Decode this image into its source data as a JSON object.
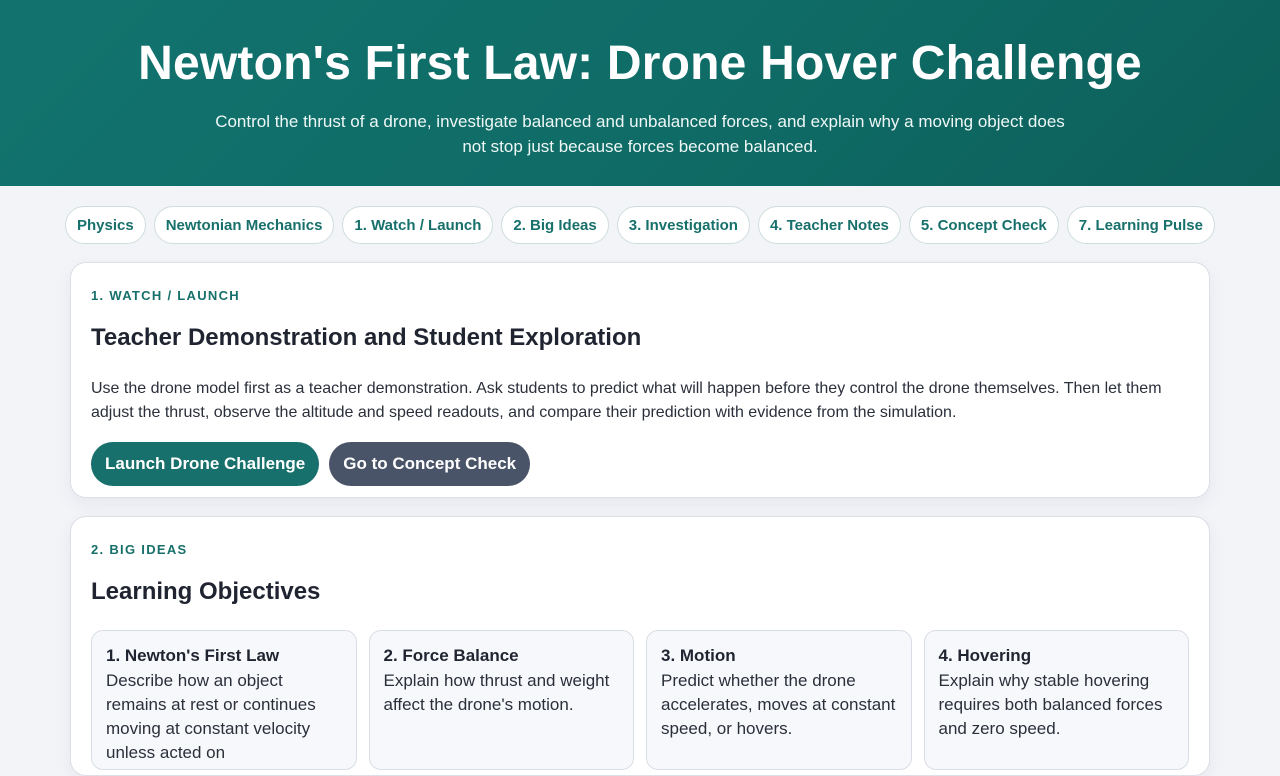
{
  "hero": {
    "title": "Newton's First Law: Drone Hover Challenge",
    "subtitle": "Control the thrust of a drone, investigate balanced and unbalanced forces, and explain why a moving object does not stop just because forces become balanced."
  },
  "nav": {
    "pills": [
      "Physics",
      "Newtonian Mechanics",
      "1. Watch / Launch",
      "2. Big Ideas",
      "3. Investigation",
      "4. Teacher Notes",
      "5. Concept Check",
      "7. Learning Pulse"
    ]
  },
  "watch": {
    "eyebrow": "1. Watch / Launch",
    "heading": "Teacher Demonstration and Student Exploration",
    "body": "Use the drone model first as a teacher demonstration. Ask students to predict what will happen before they control the drone themselves. Then let them adjust the thrust, observe the altitude and speed readouts, and compare their prediction with evidence from the simulation.",
    "launch_button": "Launch Drone Challenge",
    "concept_button": "Go to Concept Check"
  },
  "big_ideas": {
    "eyebrow": "2. Big Ideas",
    "heading": "Learning Objectives",
    "objectives": [
      {
        "title": "1. Newton's First Law",
        "text": "Describe how an object remains at rest or continues moving at constant velocity unless acted on"
      },
      {
        "title": "2. Force Balance",
        "text": "Explain how thrust and weight affect the drone's motion."
      },
      {
        "title": "3. Motion",
        "text": "Predict whether the drone accelerates, moves at constant speed, or hovers."
      },
      {
        "title": "4. Hovering",
        "text": "Explain why stable hovering requires both balanced forces and zero speed."
      }
    ]
  },
  "colors": {
    "accent": "#17706b",
    "secondary_button": "#4a5468",
    "hero_bg": "#12736e",
    "page_bg": "#f3f4f8"
  }
}
